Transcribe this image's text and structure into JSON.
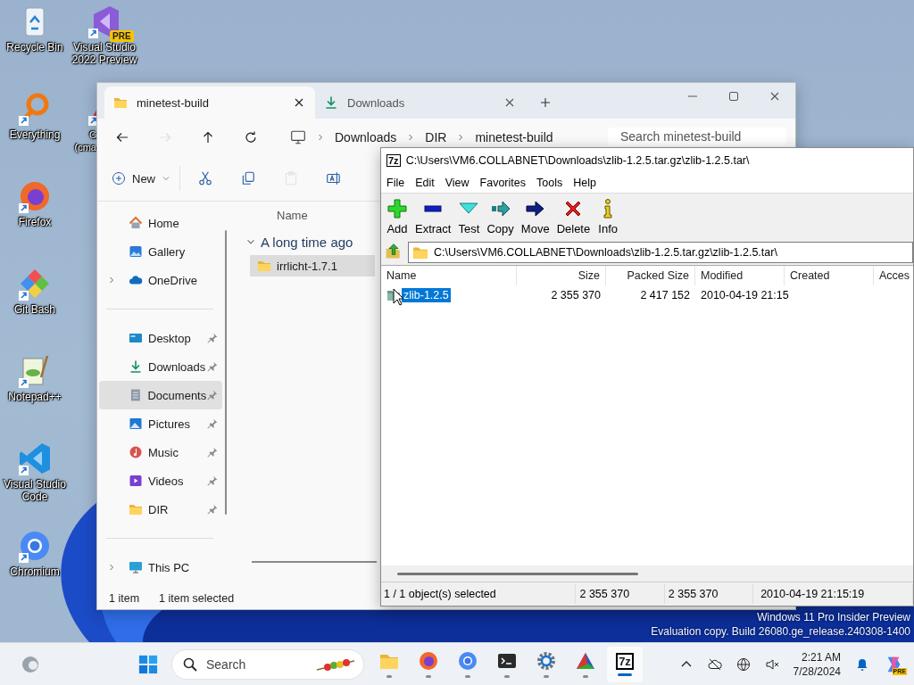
{
  "desktop": {
    "icons": [
      {
        "label": "Recycle Bin",
        "shortcut": false
      },
      {
        "label": "Everything",
        "shortcut": true
      },
      {
        "label": "Firefox",
        "shortcut": true
      },
      {
        "label": "Git Bash",
        "shortcut": true
      },
      {
        "label": "Notepad++",
        "shortcut": true
      },
      {
        "label": "Visual Studio Code",
        "shortcut": true
      },
      {
        "label": "Chromium",
        "shortcut": true
      }
    ],
    "icons_column_2": [
      {
        "label": "Visual Studio 2022 Preview",
        "shortcut": true,
        "badge": "PRE"
      },
      {
        "label": "C (cma",
        "shortcut": true
      }
    ]
  },
  "explorer": {
    "tabs": [
      {
        "label": "minetest-build",
        "selected": true
      },
      {
        "label": "Downloads",
        "selected": false
      }
    ],
    "nav_buttons": [
      {
        "disabled": false
      },
      {
        "disabled": true
      },
      {
        "disabled": false
      },
      {
        "disabled": false
      }
    ],
    "breadcrumb": [
      "Downloads",
      "DIR",
      "minetest-build"
    ],
    "search": {
      "placeholder": "Search minetest-build"
    },
    "new_button": "New",
    "tools": [
      {
        "disabled": false
      },
      {
        "disabled": false
      },
      {
        "disabled": true
      },
      {
        "disabled": false
      }
    ],
    "sidebar": {
      "groups": [
        [
          {
            "label": "Home",
            "has_children": false,
            "pinned": false,
            "selected": false
          },
          {
            "label": "Gallery",
            "has_children": false,
            "pinned": false,
            "selected": false
          },
          {
            "label": "OneDrive",
            "has_children": true,
            "pinned": false,
            "selected": false
          }
        ],
        [
          {
            "label": "Desktop",
            "has_children": false,
            "pinned": true,
            "selected": false
          },
          {
            "label": "Downloads",
            "has_children": false,
            "pinned": true,
            "selected": false
          },
          {
            "label": "Documents",
            "has_children": false,
            "pinned": true,
            "selected": true
          },
          {
            "label": "Pictures",
            "has_children": false,
            "pinned": true,
            "selected": false
          },
          {
            "label": "Music",
            "has_children": false,
            "pinned": true,
            "selected": false
          },
          {
            "label": "Videos",
            "has_children": false,
            "pinned": true,
            "selected": false
          },
          {
            "label": "DIR",
            "has_children": false,
            "pinned": true,
            "selected": false
          }
        ],
        [
          {
            "label": "This PC",
            "has_children": true,
            "pinned": false,
            "selected": false
          }
        ]
      ]
    },
    "content": {
      "column": "Name",
      "groups": [
        {
          "label": "A long time ago",
          "expanded": true,
          "items": [
            {
              "name": "irrlicht-1.7.1",
              "selected": true
            }
          ]
        }
      ]
    },
    "status_bar": {
      "count": "1 item",
      "selection": "1 item selected"
    }
  },
  "sevenzip": {
    "logo": "7z",
    "title": "C:\\Users\\VM6.COLLABNET\\Downloads\\zlib-1.2.5.tar.gz\\zlib-1.2.5.tar\\",
    "menu": [
      "File",
      "Edit",
      "View",
      "Favorites",
      "Tools",
      "Help"
    ],
    "toolbar": [
      "Add",
      "Extract",
      "Test",
      "Copy",
      "Move",
      "Delete",
      "Info"
    ],
    "address": "C:\\Users\\VM6.COLLABNET\\Downloads\\zlib-1.2.5.tar.gz\\zlib-1.2.5.tar\\",
    "table": {
      "columns": [
        "Name",
        "Size",
        "Packed Size",
        "Modified",
        "Created",
        "Acces"
      ],
      "rows": [
        {
          "cells": [
            "zlib-1.2.5",
            "2 355 370",
            "2 417 152",
            "2010-04-19 21:15"
          ],
          "selected": true
        }
      ]
    },
    "status_bar": [
      "1 / 1 object(s) selected",
      "2 355 370",
      "2 355 370",
      "2010-04-19 21:15:19"
    ]
  },
  "os_notice": [
    "Windows 11 Pro Insider Preview",
    "Evaluation copy. Build 26080.ge_release.240308-1400"
  ],
  "taskbar": {
    "search": {
      "placeholder": "Search"
    },
    "apps": [
      {
        "running": true,
        "active": false
      },
      {
        "running": true,
        "active": false
      },
      {
        "running": true,
        "active": false
      },
      {
        "running": true,
        "active": false
      },
      {
        "running": true,
        "active": false
      },
      {
        "running": true,
        "active": false
      },
      {
        "running": true,
        "active": true,
        "label": "7z"
      }
    ],
    "clock": {
      "time": "2:21 AM",
      "date": "7/28/2024"
    },
    "copilot_badge": "PRE"
  }
}
